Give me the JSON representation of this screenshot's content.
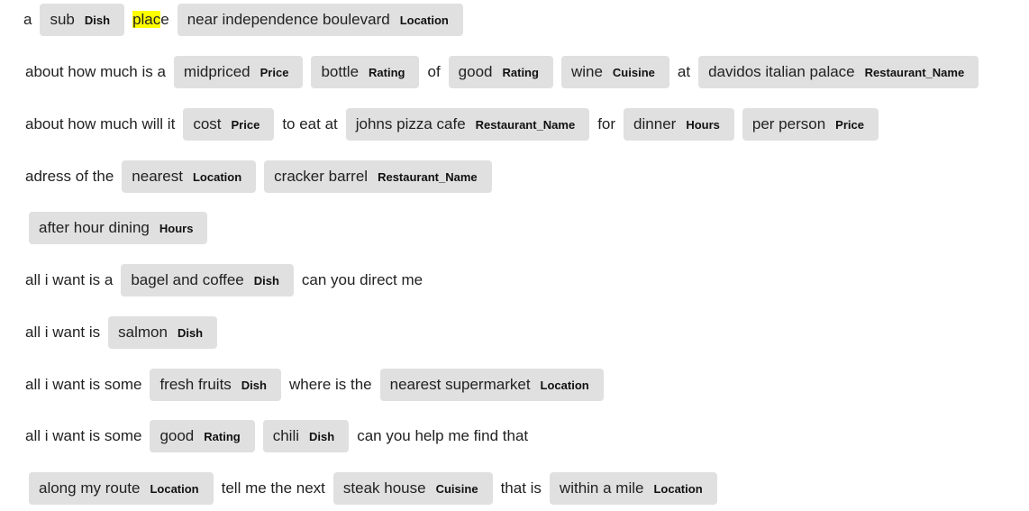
{
  "lines": [
    {
      "segments": [
        {
          "type": "text",
          "text": "a"
        },
        {
          "type": "chip",
          "text": "sub",
          "label": "Dish"
        },
        {
          "type": "highlight",
          "hl": "plac",
          "rest": "e"
        },
        {
          "type": "chip",
          "text": "near independence boulevard",
          "label": "Location"
        }
      ]
    },
    {
      "segments": [
        {
          "type": "text",
          "text": "about how much is a"
        },
        {
          "type": "chip",
          "text": "midpriced",
          "label": "Price"
        },
        {
          "type": "chip",
          "text": "bottle",
          "label": "Rating"
        },
        {
          "type": "text",
          "text": "of"
        },
        {
          "type": "chip",
          "text": "good",
          "label": "Rating"
        },
        {
          "type": "chip",
          "text": "wine",
          "label": "Cuisine"
        },
        {
          "type": "text",
          "text": "at"
        },
        {
          "type": "chip",
          "text": "davidos italian palace",
          "label": "Restaurant_Name"
        }
      ]
    },
    {
      "segments": [
        {
          "type": "text",
          "text": "about how much will it"
        },
        {
          "type": "chip",
          "text": "cost",
          "label": "Price"
        },
        {
          "type": "text",
          "text": "to eat at"
        },
        {
          "type": "chip",
          "text": "johns pizza cafe",
          "label": "Restaurant_Name"
        },
        {
          "type": "text",
          "text": "for"
        },
        {
          "type": "chip",
          "text": "dinner",
          "label": "Hours"
        },
        {
          "type": "chip",
          "text": "per person",
          "label": "Price"
        }
      ]
    },
    {
      "segments": [
        {
          "type": "text",
          "text": "adress of the"
        },
        {
          "type": "chip",
          "text": "nearest",
          "label": "Location"
        },
        {
          "type": "chip",
          "text": "cracker barrel",
          "label": "Restaurant_Name"
        }
      ]
    },
    {
      "segments": [
        {
          "type": "chip",
          "text": "after hour dining",
          "label": "Hours"
        }
      ]
    },
    {
      "segments": [
        {
          "type": "text",
          "text": "all i want is a"
        },
        {
          "type": "chip",
          "text": "bagel and coffee",
          "label": "Dish"
        },
        {
          "type": "text",
          "text": "can you direct me"
        }
      ]
    },
    {
      "segments": [
        {
          "type": "text",
          "text": "all i want is"
        },
        {
          "type": "chip",
          "text": "salmon",
          "label": "Dish"
        }
      ]
    },
    {
      "segments": [
        {
          "type": "text",
          "text": "all i want is some"
        },
        {
          "type": "chip",
          "text": "fresh fruits",
          "label": "Dish"
        },
        {
          "type": "text",
          "text": "where is the"
        },
        {
          "type": "chip",
          "text": "nearest supermarket",
          "label": "Location"
        }
      ]
    },
    {
      "segments": [
        {
          "type": "text",
          "text": "all i want is some"
        },
        {
          "type": "chip",
          "text": "good",
          "label": "Rating"
        },
        {
          "type": "chip",
          "text": "chili",
          "label": "Dish"
        },
        {
          "type": "text",
          "text": "can you help me find that"
        }
      ]
    },
    {
      "segments": [
        {
          "type": "chip",
          "text": "along my route",
          "label": "Location"
        },
        {
          "type": "text",
          "text": "tell me the next"
        },
        {
          "type": "chip",
          "text": "steak house",
          "label": "Cuisine"
        },
        {
          "type": "text",
          "text": "that is"
        },
        {
          "type": "chip",
          "text": "within a mile",
          "label": "Location"
        }
      ]
    }
  ],
  "colors": {
    "chip_bg": "#e0e0e0",
    "highlight": "#ffff00",
    "text": "#222222"
  }
}
